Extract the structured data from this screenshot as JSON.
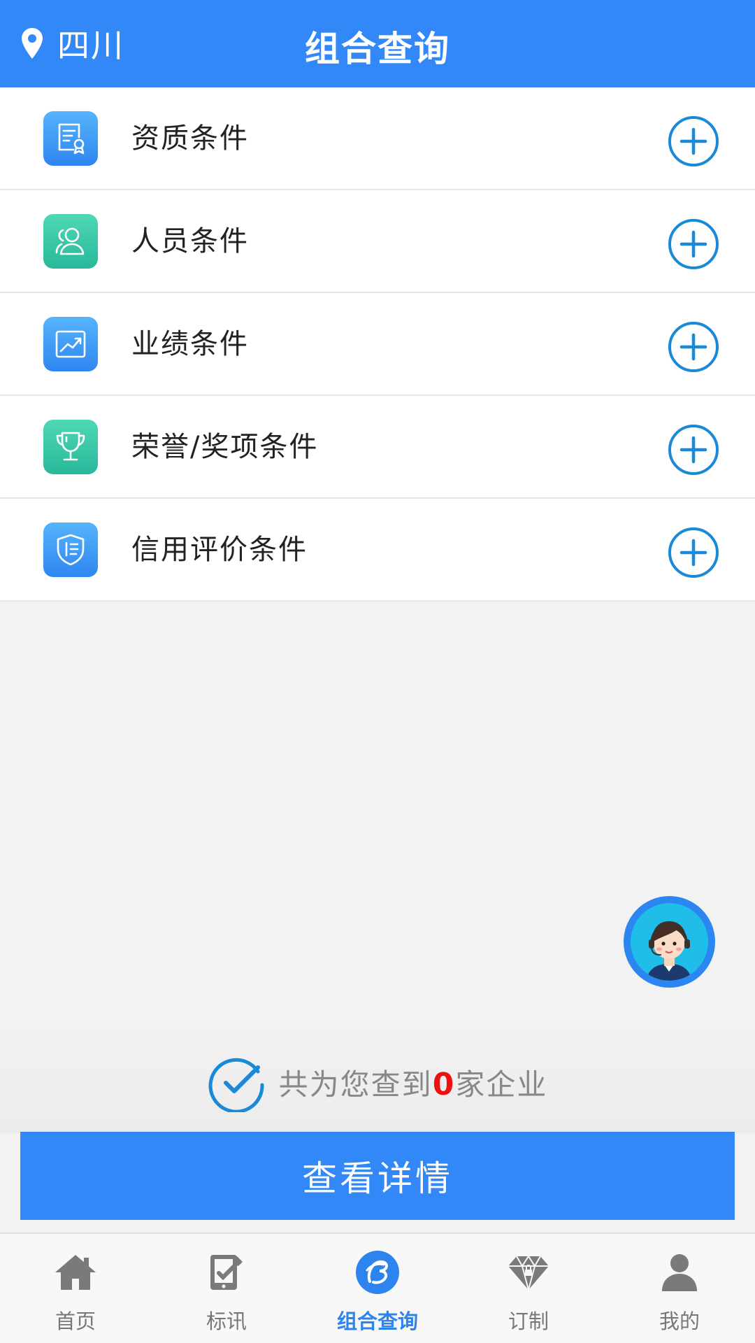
{
  "header": {
    "location": "四川",
    "title": "组合查询"
  },
  "conditions": [
    {
      "label": "资质条件",
      "icon": "certificate-icon"
    },
    {
      "label": "人员条件",
      "icon": "people-icon"
    },
    {
      "label": "业绩条件",
      "icon": "trend-chart-icon"
    },
    {
      "label": "荣誉/奖项条件",
      "icon": "trophy-icon"
    },
    {
      "label": "信用评价条件",
      "icon": "shield-icon"
    }
  ],
  "result": {
    "prefix": "共为您查到",
    "count": "0",
    "suffix": "家企业"
  },
  "detail_button": "查看详情",
  "tabs": [
    {
      "label": "首页",
      "icon": "home-icon"
    },
    {
      "label": "标讯",
      "icon": "tender-news-icon"
    },
    {
      "label": "组合查询",
      "icon": "combined-query-icon",
      "active": true
    },
    {
      "label": "订制",
      "icon": "diamond-icon"
    },
    {
      "label": "我的",
      "icon": "user-icon"
    }
  ],
  "colors": {
    "primary": "#3388f7",
    "accent_plus": "#1a8ad8",
    "count_red": "#ee1111",
    "icon_green": "#2fc0a0"
  }
}
